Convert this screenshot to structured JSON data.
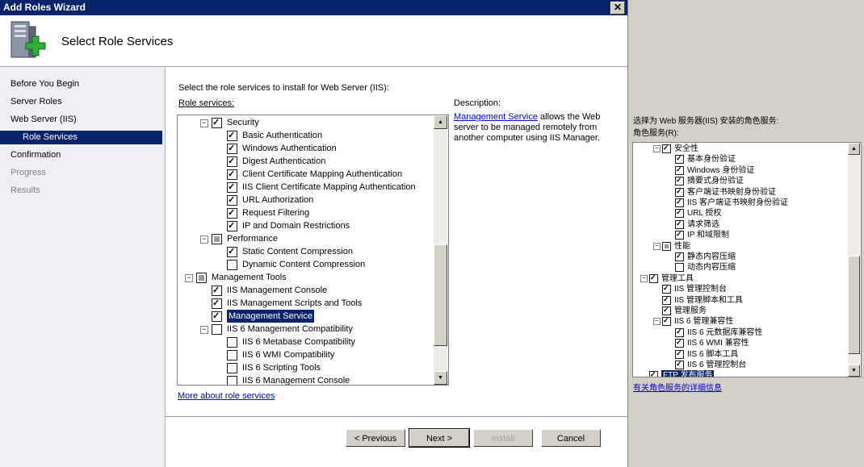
{
  "window": {
    "title": "Add Roles Wizard",
    "close_glyph": "✕"
  },
  "header": {
    "title": "Select Role Services",
    "icon": "server-add-icon"
  },
  "nav": {
    "items": [
      {
        "label": "Before You Begin",
        "state": "normal"
      },
      {
        "label": "Server Roles",
        "state": "normal"
      },
      {
        "label": "Web Server (IIS)",
        "state": "normal"
      },
      {
        "label": "Role Services",
        "state": "selected"
      },
      {
        "label": "Confirmation",
        "state": "normal"
      },
      {
        "label": "Progress",
        "state": "disabled"
      },
      {
        "label": "Results",
        "state": "disabled"
      }
    ]
  },
  "content": {
    "instruction": "Select the role services to install for Web Server (IIS):",
    "role_services_label": "Role services:",
    "description_label": "Description:",
    "description_link": "Management Service",
    "description_text": "allows the Web server to be managed remotely from another computer using IIS Manager.",
    "more_link": "More about role services",
    "tree": [
      {
        "label": "Security",
        "level": 1,
        "state": "checked",
        "expander": "⊟"
      },
      {
        "label": "Basic Authentication",
        "level": 2,
        "state": "checked"
      },
      {
        "label": "Windows Authentication",
        "level": 2,
        "state": "checked"
      },
      {
        "label": "Digest Authentication",
        "level": 2,
        "state": "checked"
      },
      {
        "label": "Client Certificate Mapping Authentication",
        "level": 2,
        "state": "checked"
      },
      {
        "label": "IIS Client Certificate Mapping Authentication",
        "level": 2,
        "state": "checked"
      },
      {
        "label": "URL Authorization",
        "level": 2,
        "state": "checked"
      },
      {
        "label": "Request Filtering",
        "level": 2,
        "state": "checked"
      },
      {
        "label": "IP and Domain Restrictions",
        "level": 2,
        "state": "checked"
      },
      {
        "label": "Performance",
        "level": 1,
        "state": "partial",
        "expander": "⊟"
      },
      {
        "label": "Static Content Compression",
        "level": 2,
        "state": "checked"
      },
      {
        "label": "Dynamic Content Compression",
        "level": 2,
        "state": "unchecked"
      },
      {
        "label": "Management Tools",
        "level": 0,
        "state": "partial",
        "expander": "⊟"
      },
      {
        "label": "IIS Management Console",
        "level": 1,
        "state": "checked"
      },
      {
        "label": "IIS Management Scripts and Tools",
        "level": 1,
        "state": "checked"
      },
      {
        "label": "Management Service",
        "level": 1,
        "state": "checked",
        "selected": true
      },
      {
        "label": "IIS 6 Management Compatibility",
        "level": 1,
        "state": "unchecked",
        "expander": "⊟"
      },
      {
        "label": "IIS 6 Metabase Compatibility",
        "level": 2,
        "state": "unchecked"
      },
      {
        "label": "IIS 6 WMI Compatibility",
        "level": 2,
        "state": "unchecked"
      },
      {
        "label": "IIS 6 Scripting Tools",
        "level": 2,
        "state": "unchecked"
      },
      {
        "label": "IIS 6 Management Console",
        "level": 2,
        "state": "unchecked"
      }
    ]
  },
  "buttons": {
    "previous": "< Previous",
    "next": "Next >",
    "install": "Install",
    "cancel": "Cancel"
  },
  "cn_panel": {
    "instruction": "选择为 Web 服务器(IIS) 安装的角色服务:",
    "role_services_label": "角色服务(R):",
    "more_link": "有关角色服务的详细信息",
    "tree": [
      {
        "label": "安全性",
        "level": 1,
        "state": "checked",
        "expander": "⊟"
      },
      {
        "label": "基本身份验证",
        "level": 2,
        "state": "checked"
      },
      {
        "label": "Windows 身份验证",
        "level": 2,
        "state": "checked"
      },
      {
        "label": "摘要式身份验证",
        "level": 2,
        "state": "checked"
      },
      {
        "label": "客户端证书映射身份验证",
        "level": 2,
        "state": "checked"
      },
      {
        "label": "IIS 客户端证书映射身份验证",
        "level": 2,
        "state": "checked"
      },
      {
        "label": "URL 授权",
        "level": 2,
        "state": "checked"
      },
      {
        "label": "请求筛选",
        "level": 2,
        "state": "checked"
      },
      {
        "label": "IP 和域限制",
        "level": 2,
        "state": "checked"
      },
      {
        "label": "性能",
        "level": 1,
        "state": "partial",
        "expander": "⊟"
      },
      {
        "label": "静态内容压缩",
        "level": 2,
        "state": "checked"
      },
      {
        "label": "动态内容压缩",
        "level": 2,
        "state": "unchecked"
      },
      {
        "label": "管理工具",
        "level": 0,
        "state": "checked",
        "expander": "⊟"
      },
      {
        "label": "IIS 管理控制台",
        "level": 1,
        "state": "checked"
      },
      {
        "label": "IIS 管理脚本和工具",
        "level": 1,
        "state": "checked"
      },
      {
        "label": "管理服务",
        "level": 1,
        "state": "checked"
      },
      {
        "label": "IIS 6 管理兼容性",
        "level": 1,
        "state": "checked",
        "expander": "⊟"
      },
      {
        "label": "IIS 6 元数据库兼容性",
        "level": 2,
        "state": "checked"
      },
      {
        "label": "IIS 6 WMI 兼容性",
        "level": 2,
        "state": "checked"
      },
      {
        "label": "IIS 6 脚本工具",
        "level": 2,
        "state": "checked"
      },
      {
        "label": "IIS 6 管理控制台",
        "level": 2,
        "state": "checked"
      },
      {
        "label": "FTP 发布服务",
        "level": 0,
        "state": "checked",
        "selected": true
      }
    ]
  }
}
